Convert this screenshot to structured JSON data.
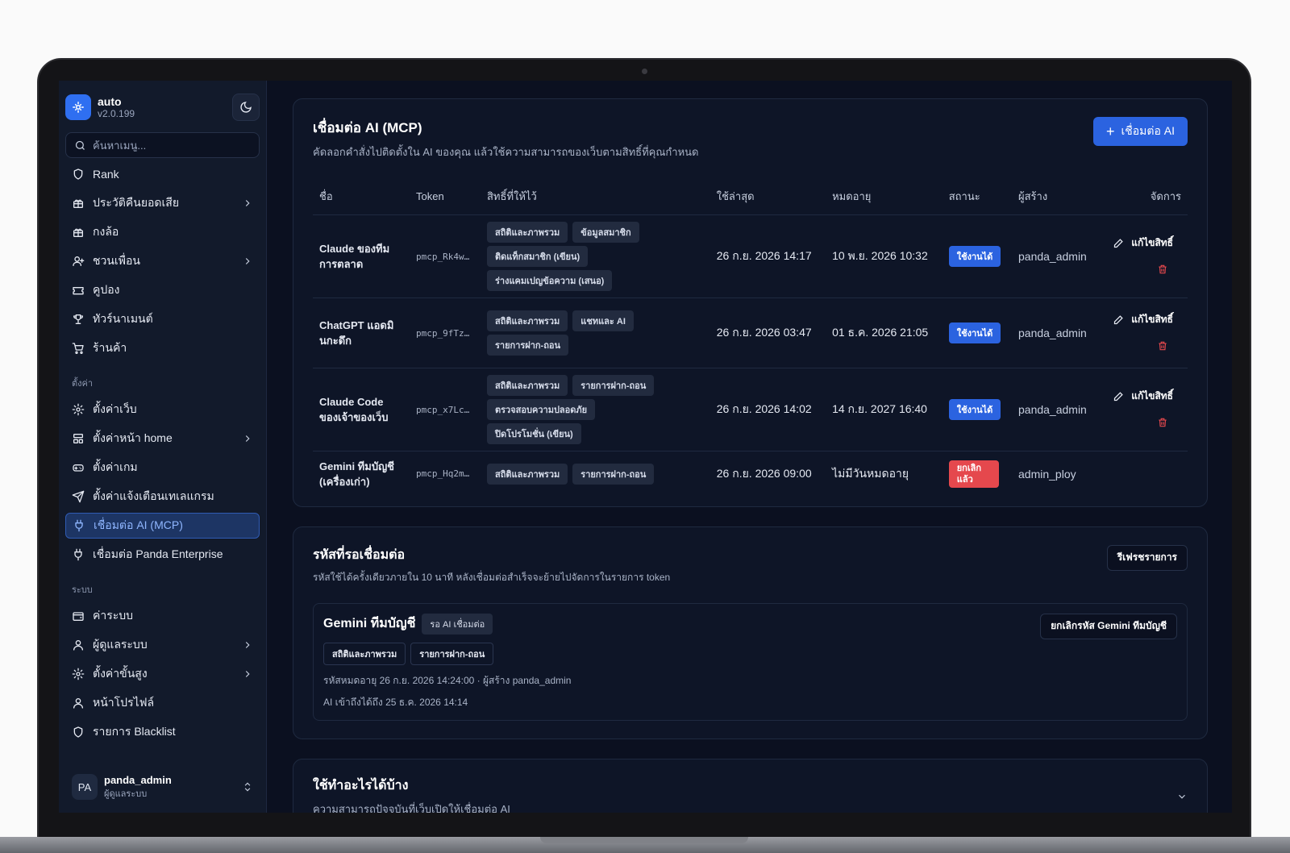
{
  "app": {
    "name": "auto",
    "version": "v2.0.199"
  },
  "search": {
    "placeholder": "ค้นหาเมนู..."
  },
  "nav": {
    "main": [
      {
        "label": "Rank",
        "icon": "shield-icon",
        "chevron": false
      },
      {
        "label": "ประวัติคืนยอดเสีย",
        "icon": "gift-icon",
        "chevron": true
      },
      {
        "label": "กงล้อ",
        "icon": "gift-icon",
        "chevron": false
      },
      {
        "label": "ชวนเพื่อน",
        "icon": "user-plus-icon",
        "chevron": true
      },
      {
        "label": "คูปอง",
        "icon": "ticket-icon",
        "chevron": false
      },
      {
        "label": "ทัวร์นาเมนต์",
        "icon": "trophy-icon",
        "chevron": false
      },
      {
        "label": "ร้านค้า",
        "icon": "cart-icon",
        "chevron": false
      }
    ],
    "settings_header": "ตั้งค่า",
    "settings": [
      {
        "label": "ตั้งค่าเว็บ",
        "icon": "gear-icon",
        "chevron": false
      },
      {
        "label": "ตั้งค่าหน้า home",
        "icon": "layout-icon",
        "chevron": true
      },
      {
        "label": "ตั้งค่าเกม",
        "icon": "gamepad-icon",
        "chevron": false
      },
      {
        "label": "ตั้งค่าแจ้งเตือนเทเลแกรม",
        "icon": "send-icon",
        "chevron": false
      },
      {
        "label": "เชื่อมต่อ AI (MCP)",
        "icon": "plug-icon",
        "chevron": false,
        "active": true
      },
      {
        "label": "เชื่อมต่อ Panda Enterprise",
        "icon": "plug-icon",
        "chevron": false
      }
    ],
    "system_header": "ระบบ",
    "system": [
      {
        "label": "ค่าระบบ",
        "icon": "wallet-icon",
        "chevron": false
      },
      {
        "label": "ผู้ดูแลระบบ",
        "icon": "user-icon",
        "chevron": true
      },
      {
        "label": "ตั้งค่าขั้นสูง",
        "icon": "gear-icon",
        "chevron": true
      },
      {
        "label": "หน้าโปรไฟล์",
        "icon": "user-icon",
        "chevron": false
      },
      {
        "label": "รายการ Blacklist",
        "icon": "shield-icon",
        "chevron": false
      }
    ]
  },
  "user": {
    "initials": "PA",
    "name": "panda_admin",
    "role": "ผู้ดูแลระบบ"
  },
  "mcp": {
    "title": "เชื่อมต่อ AI (MCP)",
    "subtitle": "คัดลอกคำสั่งไปติดตั้งใน AI ของคุณ แล้วใช้ความสามารถของเว็บตามสิทธิ์ที่คุณกำหนด",
    "connect_button": "เชื่อมต่อ AI",
    "columns": [
      "ชื่อ",
      "Token",
      "สิทธิ์ที่ให้ไว้",
      "ใช้ล่าสุด",
      "หมดอายุ",
      "สถานะ",
      "ผู้สร้าง",
      "จัดการ"
    ],
    "edit_label": "แก้ไขสิทธิ์",
    "rows": [
      {
        "name": "Claude ของทีมการตลาด",
        "token": "pmcp_Rk4w…",
        "perms": [
          "สถิติและภาพรวม",
          "ข้อมูลสมาชิก",
          "ติดแท็กสมาชิก (เขียน)",
          "ร่างแคมเปญข้อความ (เสนอ)"
        ],
        "last_used": "26 ก.ย. 2026 14:17",
        "expires": "10 พ.ย. 2026 10:32",
        "status": "ใช้งานได้",
        "status_type": "active",
        "creator": "panda_admin",
        "editable": true
      },
      {
        "name": "ChatGPT แอดมินกะดึก",
        "token": "pmcp_9fTz…",
        "perms": [
          "สถิติและภาพรวม",
          "แชทและ AI",
          "รายการฝาก-ถอน"
        ],
        "last_used": "26 ก.ย. 2026 03:47",
        "expires": "01 ธ.ค. 2026 21:05",
        "status": "ใช้งานได้",
        "status_type": "active",
        "creator": "panda_admin",
        "editable": true
      },
      {
        "name": "Claude Code ของเจ้าของเว็บ",
        "token": "pmcp_x7Lc…",
        "perms": [
          "สถิติและภาพรวม",
          "รายการฝาก-ถอน",
          "ตรวจสอบความปลอดภัย",
          "ปิดโปรโมชั่น (เขียน)"
        ],
        "last_used": "26 ก.ย. 2026 14:02",
        "expires": "14 ก.ย. 2027 16:40",
        "status": "ใช้งานได้",
        "status_type": "active",
        "creator": "panda_admin",
        "editable": true
      },
      {
        "name": "Gemini ทีมบัญชี (เครื่องเก่า)",
        "token": "pmcp_Hq2m…",
        "perms": [
          "สถิติและภาพรวม",
          "รายการฝาก-ถอน"
        ],
        "last_used": "26 ก.ย. 2026 09:00",
        "expires": "ไม่มีวันหมดอายุ",
        "status": "ยกเลิกแล้ว",
        "status_type": "cancelled",
        "creator": "admin_ploy",
        "editable": false
      }
    ]
  },
  "pending": {
    "title": "รหัสที่รอเชื่อมต่อ",
    "subtitle": "รหัสใช้ได้ครั้งเดียวภายใน 10 นาที หลังเชื่อมต่อสำเร็จจะย้ายไปจัดการในรายการ token",
    "refresh_button": "รีเฟรชรายการ",
    "item": {
      "name": "Gemini ทีมบัญชี",
      "badge": "รอ AI เชื่อมต่อ",
      "perms": [
        "สถิติและภาพรวม",
        "รายการฝาก-ถอน"
      ],
      "meta": "รหัสหมดอายุ 26 ก.ย. 2026 14:24:00 · ผู้สร้าง panda_admin",
      "access": "AI เข้าถึงได้ถึง 25 ธ.ค. 2026 14:14",
      "cancel_button": "ยกเลิกรหัส Gemini ทีมบัญชี"
    }
  },
  "abilities": {
    "title": "ใช้ทำอะไรได้บ้าง",
    "subtitle": "ความสามารถปัจจุบันที่เว็บเปิดให้เชื่อมต่อ AI"
  }
}
